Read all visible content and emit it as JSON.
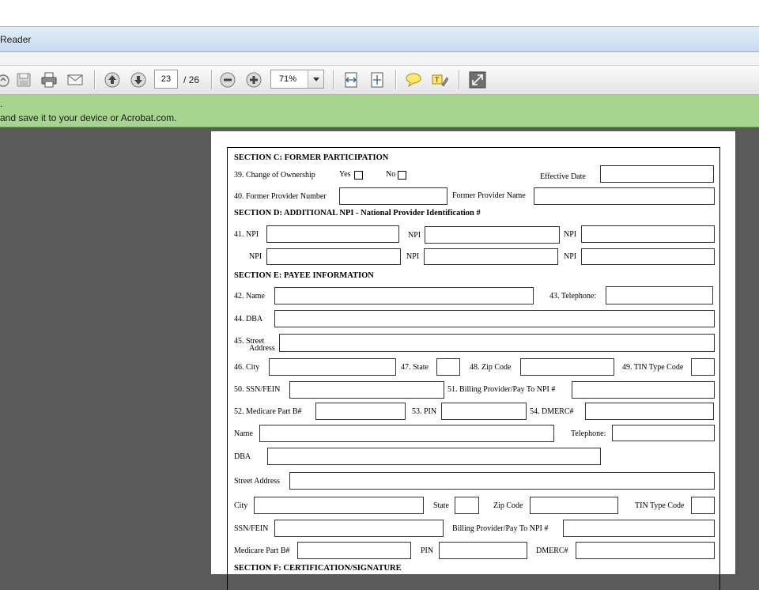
{
  "window": {
    "title": "Reader"
  },
  "toolbar": {
    "icons": [
      "cloud-icon",
      "save-icon",
      "print-icon",
      "email-icon",
      "previous-page-icon",
      "next-page-icon",
      "zoom-out-icon",
      "zoom-in-icon",
      "fit-width-icon",
      "fit-page-icon",
      "comment-icon",
      "highlight-icon",
      "fullscreen-icon"
    ],
    "page_current": "23",
    "page_total": "/ 26",
    "zoom": "71%"
  },
  "notification": {
    "line1": ".",
    "line2": "and save it to your device or Acrobat.com."
  },
  "form": {
    "sec_c": "SECTION C:  FORMER PARTICIPATION",
    "l39": "39.  Change of Ownership",
    "yes": "Yes",
    "no": "No",
    "eff_date": "Effective Date",
    "l40": "40.  Former Provider Number",
    "former_name": "Former Provider Name",
    "sec_d": "SECTION D:  ADDITIONAL NPI - National Provider Identification #",
    "l41": "41.  NPI",
    "npi": "NPI",
    "sec_e": "SECTION E:  PAYEE INFORMATION",
    "l42": "42.  Name",
    "l43": "43. Telephone:",
    "l44": "44.  DBA",
    "l45a": "45.  Street",
    "l45b": "Address",
    "l46": "46.  City",
    "l47": "47.  State",
    "l48": "48.  Zip Code",
    "l49": "49.  TIN Type Code",
    "l50": "50.  SSN/FEIN",
    "l51": "51.  Billing Provider/Pay To NPI #",
    "l52": "52.  Medicare Part B#",
    "l53": "53. PIN",
    "l54": "54.  DMERC#",
    "name": "Name",
    "telephone": "Telephone:",
    "dba": "DBA",
    "street_address": "Street Address",
    "city": "City",
    "state": "State",
    "zip": "Zip Code",
    "tin": "TIN Type Code",
    "ssn": "SSN/FEIN",
    "billing": "Billing Provider/Pay To NPI #",
    "medicare": "Medicare Part B#",
    "pin": "PIN",
    "dmerc": "DMERC#",
    "sec_f": "SECTION F:  CERTIFICATION/SIGNATURE"
  },
  "colors": {
    "notification_bg": "#a6d590",
    "workspace_bg": "#5a5a5a"
  }
}
